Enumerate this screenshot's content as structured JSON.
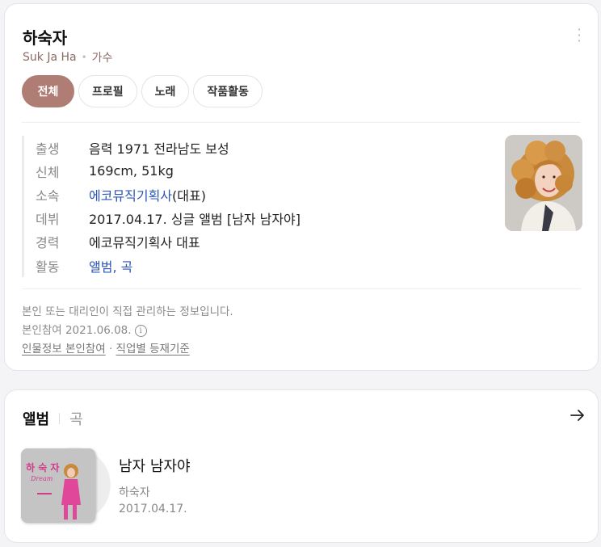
{
  "profile": {
    "name": "하숙자",
    "romanized": "Suk Ja Ha",
    "occupation": "가수",
    "menu_icon": "kebab-menu-icon",
    "tabs": [
      {
        "label": "전체",
        "active": true
      },
      {
        "label": "프로필",
        "active": false
      },
      {
        "label": "노래",
        "active": false
      },
      {
        "label": "작품활동",
        "active": false
      }
    ],
    "info": {
      "birth": {
        "label": "출생",
        "value": "음력 1971 전라남도 보성"
      },
      "body": {
        "label": "신체",
        "value": "169cm, 51kg"
      },
      "agency": {
        "label": "소속",
        "link": "에코뮤직기획사",
        "suffix": "(대표)"
      },
      "debut": {
        "label": "데뷔",
        "value": "2017.04.17. 싱글 앨범 [남자 남자야]"
      },
      "career": {
        "label": "경력",
        "value": "에코뮤직기획사 대표"
      },
      "activity": {
        "label": "활동",
        "link1": "앨범",
        "comma": ", ",
        "link2": "곡"
      }
    },
    "notice": {
      "line1": "본인 또는 대리인이 직접 관리하는 정보입니다.",
      "line2": "본인참여 2021.06.08.",
      "info_icon": "i",
      "link1": "인물정보 본인참여",
      "dot": "·",
      "link2": "직업별 등재기준"
    }
  },
  "albums": {
    "tab_album": "앨범",
    "tab_song": "곡",
    "arrow_icon": "arrow-right-icon",
    "item": {
      "title": "남자 남자야",
      "artist": "하숙자",
      "date": "2017.04.17.",
      "cover_text": "하 숙 자",
      "cover_script": "Dream"
    }
  },
  "colors": {
    "accent": "#b07d74",
    "link": "#2a54b8"
  }
}
